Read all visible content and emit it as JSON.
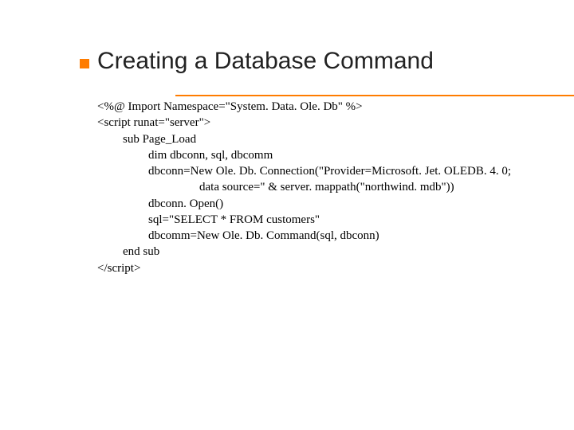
{
  "title": "Creating a Database Command",
  "code": {
    "l1": "<%@ Import Namespace=\"System. Data. Ole. Db\" %>",
    "l2": "<script runat=\"server\">",
    "l3": "sub Page_Load",
    "l4": "dim dbconn, sql, dbcomm",
    "l5": "dbconn=New Ole. Db. Connection(\"Provider=Microsoft. Jet. OLEDB. 4. 0;",
    "l6": "data source=\" & server. mappath(\"northwind. mdb\"))",
    "l7": "dbconn. Open()",
    "l8": "sql=\"SELECT * FROM customers\"",
    "l9": "dbcomm=New Ole. Db. Command(sql, dbconn)",
    "l10": "end sub",
    "l11": "</script>"
  }
}
